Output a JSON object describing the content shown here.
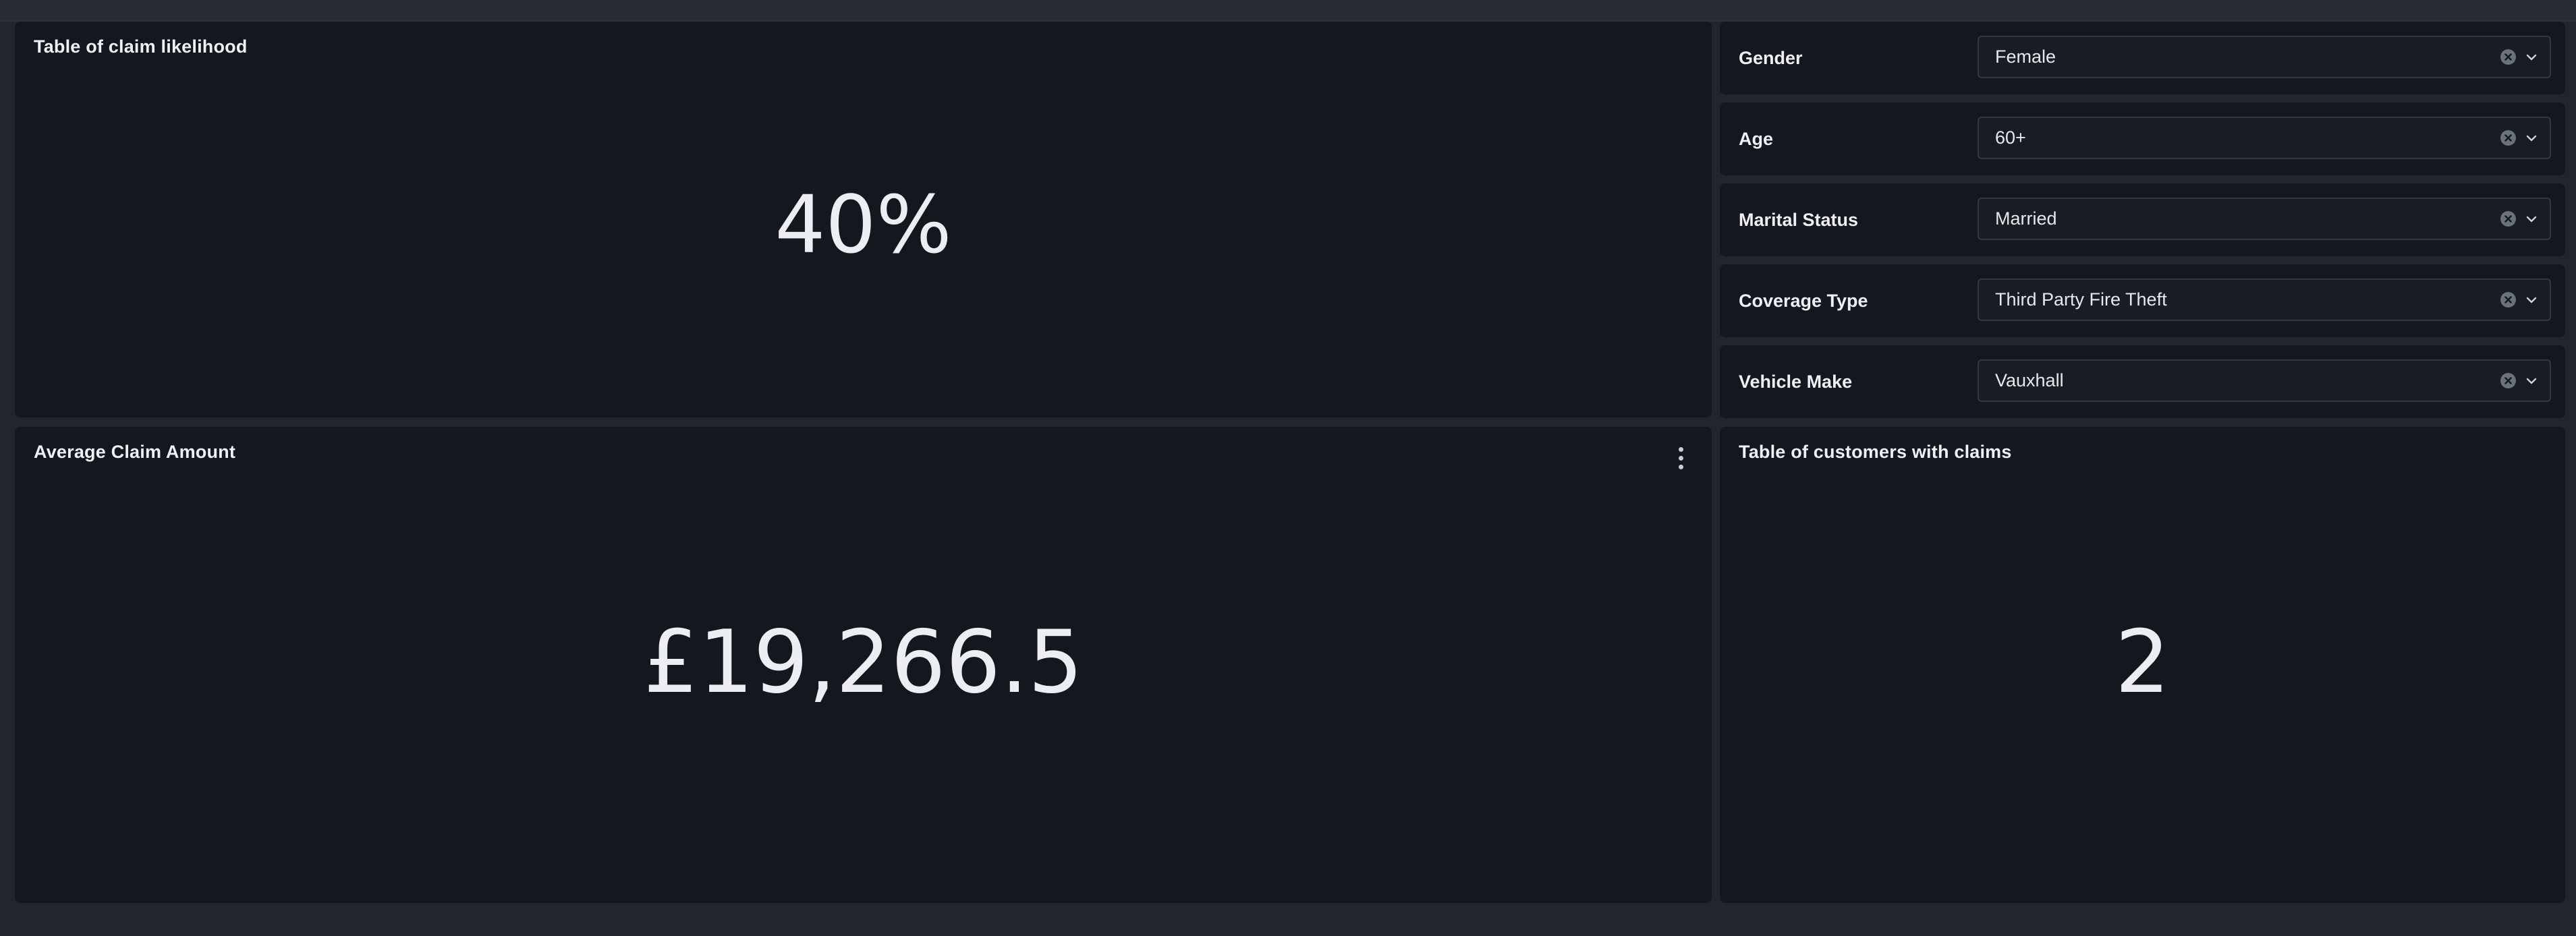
{
  "panels": {
    "claim_likelihood": {
      "title": "Table of claim likelihood",
      "value": "40%"
    },
    "average_claim": {
      "title": "Average Claim Amount",
      "value": "£19,266.5",
      "menu_icon": "kebab-menu-icon"
    },
    "customers_with_claims": {
      "title": "Table of customers with claims",
      "value": "2"
    }
  },
  "filters": [
    {
      "label": "Gender",
      "value": "Female"
    },
    {
      "label": "Age",
      "value": "60+"
    },
    {
      "label": "Marital Status",
      "value": "Married"
    },
    {
      "label": "Coverage Type",
      "value": "Third Party Fire Theft"
    },
    {
      "label": "Vehicle Make",
      "value": "Vauxhall"
    }
  ],
  "icons": {
    "clear": "clear-icon",
    "dropdown": "chevron-down-icon"
  },
  "colors": {
    "background": "#22252b",
    "panel": "#13171e",
    "text": "#eceef1"
  }
}
